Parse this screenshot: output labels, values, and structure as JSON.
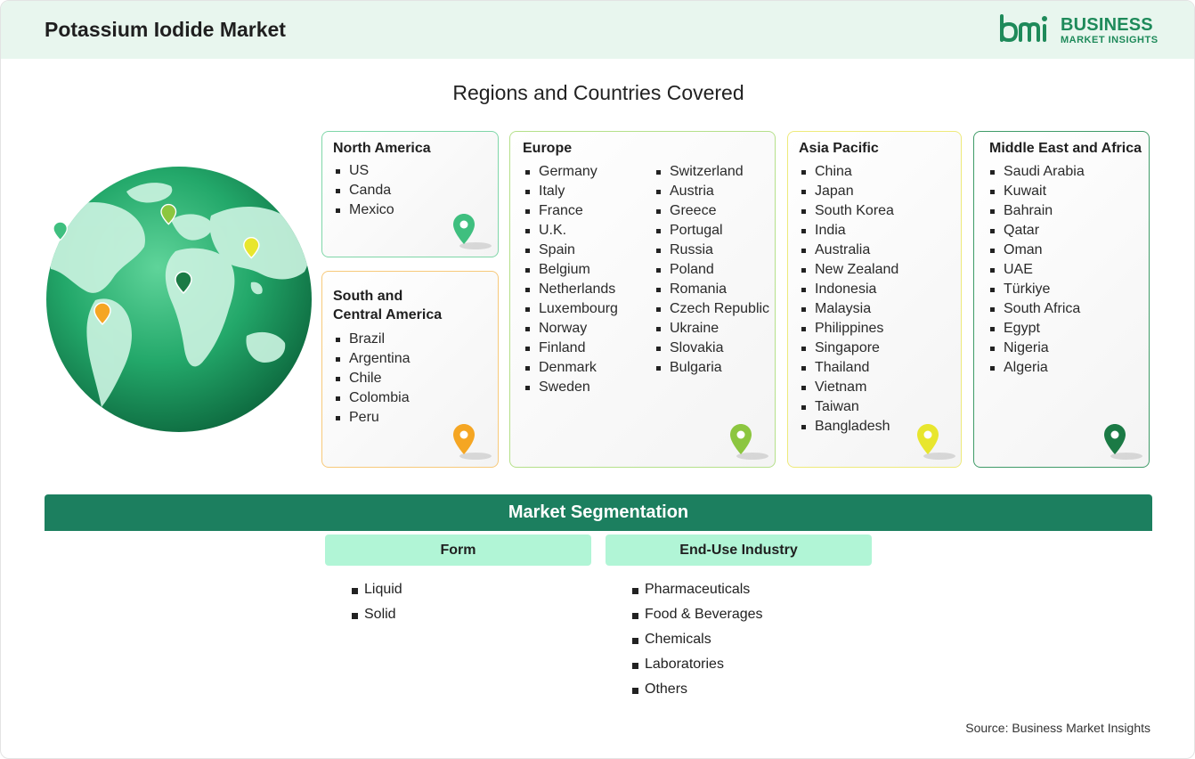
{
  "header": {
    "title": "Potassium Iodide Market"
  },
  "logo": {
    "mark": "bmi",
    "line1": "BUSINESS",
    "line2": "MARKET INSIGHTS"
  },
  "regions": {
    "title": "Regions and Countries Covered",
    "north_america": {
      "title": "North America",
      "countries": [
        "US",
        "Canda",
        "Mexico"
      ],
      "pin_color": "#3fbf7f"
    },
    "south_central_america": {
      "title_line1": "South and",
      "title_line2": "Central America",
      "countries": [
        "Brazil",
        "Argentina",
        "Chile",
        "Colombia",
        "Peru"
      ],
      "pin_color": "#f5a623"
    },
    "europe": {
      "title": "Europe",
      "countries_col1": [
        "Germany",
        "Italy",
        "France",
        "U.K.",
        "Spain",
        "Belgium",
        "Netherlands",
        "Luxembourg",
        "Norway",
        "Finland",
        "Denmark",
        "Sweden"
      ],
      "countries_col2": [
        "Switzerland",
        "Austria",
        "Greece",
        "Portugal",
        "Russia",
        "Poland",
        "Romania",
        "Czech Republic",
        "Ukraine",
        "Slovakia",
        "Bulgaria"
      ],
      "pin_color": "#8cc63f"
    },
    "asia_pacific": {
      "title": "Asia Pacific",
      "countries": [
        "China",
        "Japan",
        "South Korea",
        "India",
        "Australia",
        "New Zealand",
        "Indonesia",
        "Malaysia",
        "Philippines",
        "Singapore",
        "Thailand",
        "Vietnam",
        "Taiwan",
        "Bangladesh"
      ],
      "pin_color": "#e8e62e"
    },
    "middle_east_africa": {
      "title": "Middle East and Africa",
      "countries": [
        "Saudi Arabia",
        "Kuwait",
        "Bahrain",
        "Qatar",
        "Oman",
        "UAE",
        "Türkiye",
        "South Africa",
        "Egypt",
        "Nigeria",
        "Algeria"
      ],
      "pin_color": "#1b7a45"
    }
  },
  "segmentation": {
    "title": "Market Segmentation",
    "form": {
      "title": "Form",
      "items": [
        "Liquid",
        "Solid"
      ]
    },
    "end_use": {
      "title": "End-Use Industry",
      "items": [
        "Pharmaceuticals",
        "Food & Beverages",
        "Chemicals",
        "Laboratories",
        "Others"
      ]
    }
  },
  "source": "Source: Business Market Insights",
  "colors": {
    "brand": "#1e8a5a",
    "segment_bar": "#1c7f5f",
    "segment_head": "#b1f5d6",
    "header_bg": "#e8f6ee"
  }
}
